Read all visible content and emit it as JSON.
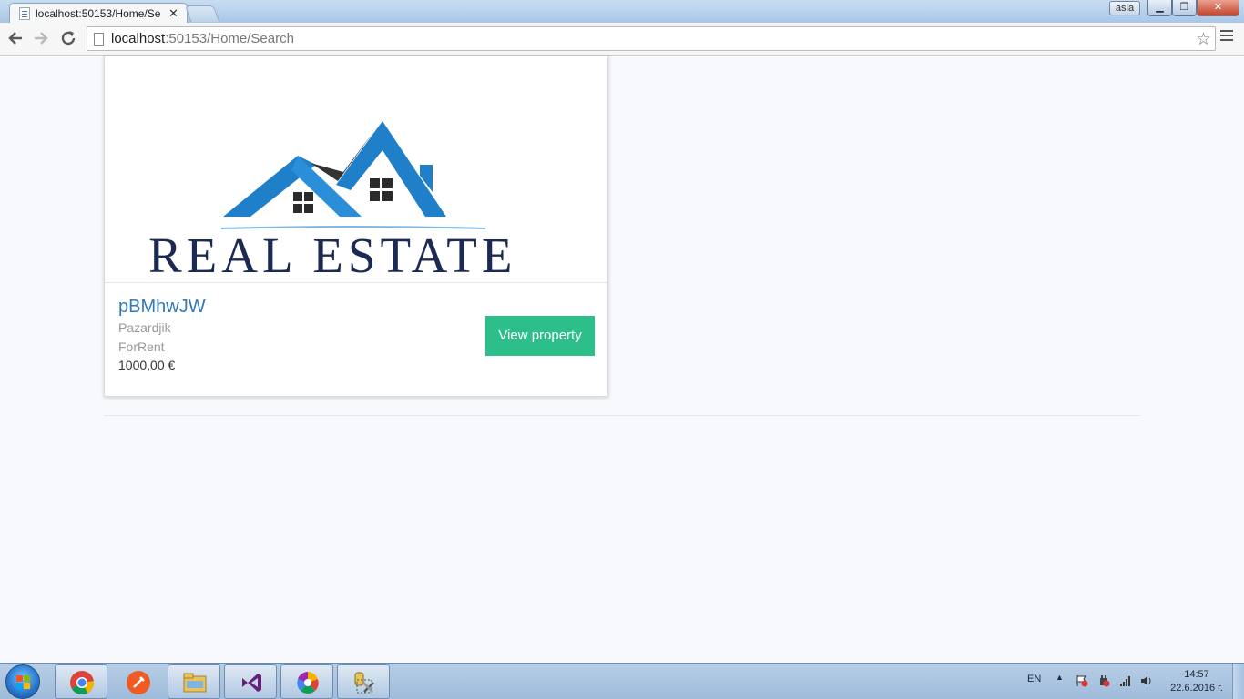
{
  "browser": {
    "tab_title": "localhost:50153/Home/Se",
    "tab_close": "✕",
    "user_badge": "asia",
    "url_host": "localhost",
    "url_rest": ":50153/Home/Search",
    "back_icon": "back-arrow-icon",
    "forward_icon": "forward-arrow-icon",
    "reload_icon": "reload-icon",
    "star_icon": "star-icon",
    "menu_icon": "hamburger-menu-icon"
  },
  "listing": {
    "logo_text": "REAL ESTATE",
    "title": "pBMhwJW",
    "town": "Pazardjik",
    "type": "ForRent",
    "price": "1000,00 €",
    "button_label": "View property"
  },
  "taskbar": {
    "language": "EN",
    "time": "14:57",
    "date": "22.6.2016 г.",
    "pinned_apps": [
      "chrome-icon",
      "postman-icon",
      "file-explorer-icon",
      "visual-studio-icon",
      "picasa-icon",
      "database-tools-icon"
    ]
  },
  "colors": {
    "accent_button": "#2cbf8a",
    "title_link": "#337ab7",
    "logo_navy": "#1b2a55",
    "logo_blue": "#1f7fc8"
  }
}
